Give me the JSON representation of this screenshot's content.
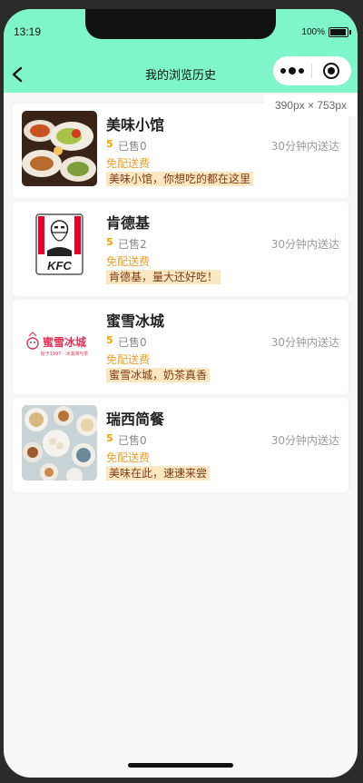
{
  "status_bar": {
    "time": "13:19",
    "battery": "100%"
  },
  "nav": {
    "title": "我的浏览历史",
    "size_tag": "390px × 753px"
  },
  "shops": [
    {
      "name": "美味小馆",
      "rating": "5",
      "sold": "已售0",
      "delivery": "30分钟内送达",
      "free_ship": "免配送费",
      "slogan": "美味小馆，你想吃的都在这里"
    },
    {
      "name": "肯德基",
      "rating": "5",
      "sold": "已售2",
      "delivery": "30分钟内送达",
      "free_ship": "免配送费",
      "slogan": "肯德基，量大还好吃！"
    },
    {
      "name": "蜜雪冰城",
      "rating": "5",
      "sold": "已售0",
      "delivery": "30分钟内送达",
      "free_ship": "免配送费",
      "slogan": "蜜雪冰城，奶茶真香"
    },
    {
      "name": "瑞西简餐",
      "rating": "5",
      "sold": "已售0",
      "delivery": "30分钟内送达",
      "free_ship": "免配送费",
      "slogan": "美味在此，速速来尝"
    }
  ],
  "logos": {
    "kfc_text": "KFC",
    "mixue_text": "蜜雪冰城",
    "mixue_sub": "始于1997 · 冰淇淋与茶"
  },
  "colors": {
    "header": "#7ef5cb",
    "accent": "#f0a500",
    "free_ship": "#e8a12b",
    "slogan_bg": "#fde6c2"
  }
}
